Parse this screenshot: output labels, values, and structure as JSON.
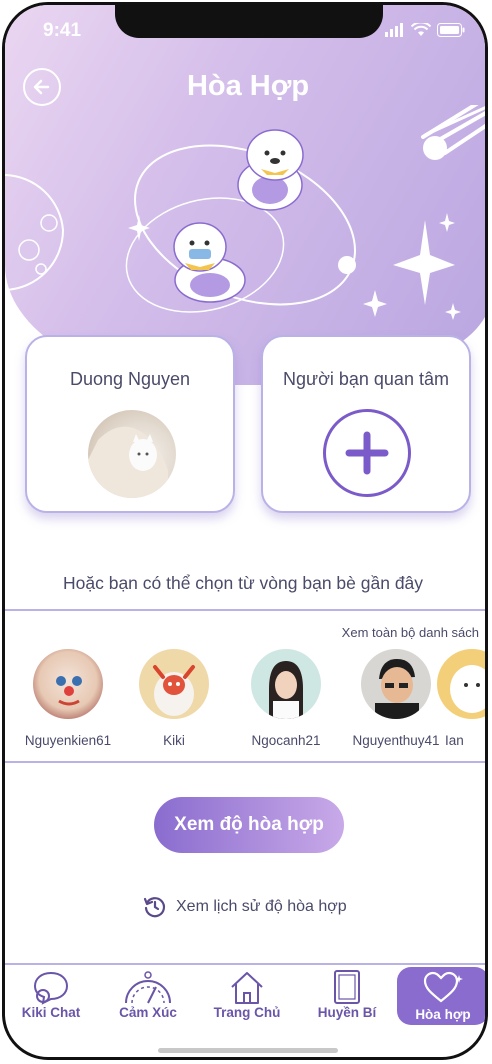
{
  "status_bar": {
    "time": "9:41"
  },
  "header": {
    "title": "Hòa Hợp"
  },
  "cards": {
    "user_name": "Duong Nguyen",
    "partner_label": "Người bạn quan tâm"
  },
  "friends_section": {
    "heading": "Hoặc bạn có thể chọn từ vòng bạn bè gần đây",
    "view_all": "Xem toàn bộ danh sách",
    "items": [
      {
        "name": "Nguyenkien61"
      },
      {
        "name": "Kiki"
      },
      {
        "name": "Ngocanh21"
      },
      {
        "name": "Nguyenthuy41"
      },
      {
        "name": "Ian"
      }
    ]
  },
  "actions": {
    "cta": "Xem độ hòa hợp",
    "history": "Xem lịch sử độ hòa hợp"
  },
  "tabbar": {
    "items": [
      {
        "label": "Kiki Chat",
        "icon": "chat-icon"
      },
      {
        "label": "Cảm Xúc",
        "icon": "mood-gauge-icon"
      },
      {
        "label": "Trang Chủ",
        "icon": "home-icon"
      },
      {
        "label": "Huyền Bí",
        "icon": "tarot-card-icon"
      },
      {
        "label": "Hòa hợp",
        "icon": "heart-icon"
      }
    ],
    "active": "Hòa hợp"
  },
  "colors": {
    "accent": "#8a6ccf",
    "text": "#4a4a6a",
    "border": "#b9b2e6"
  }
}
